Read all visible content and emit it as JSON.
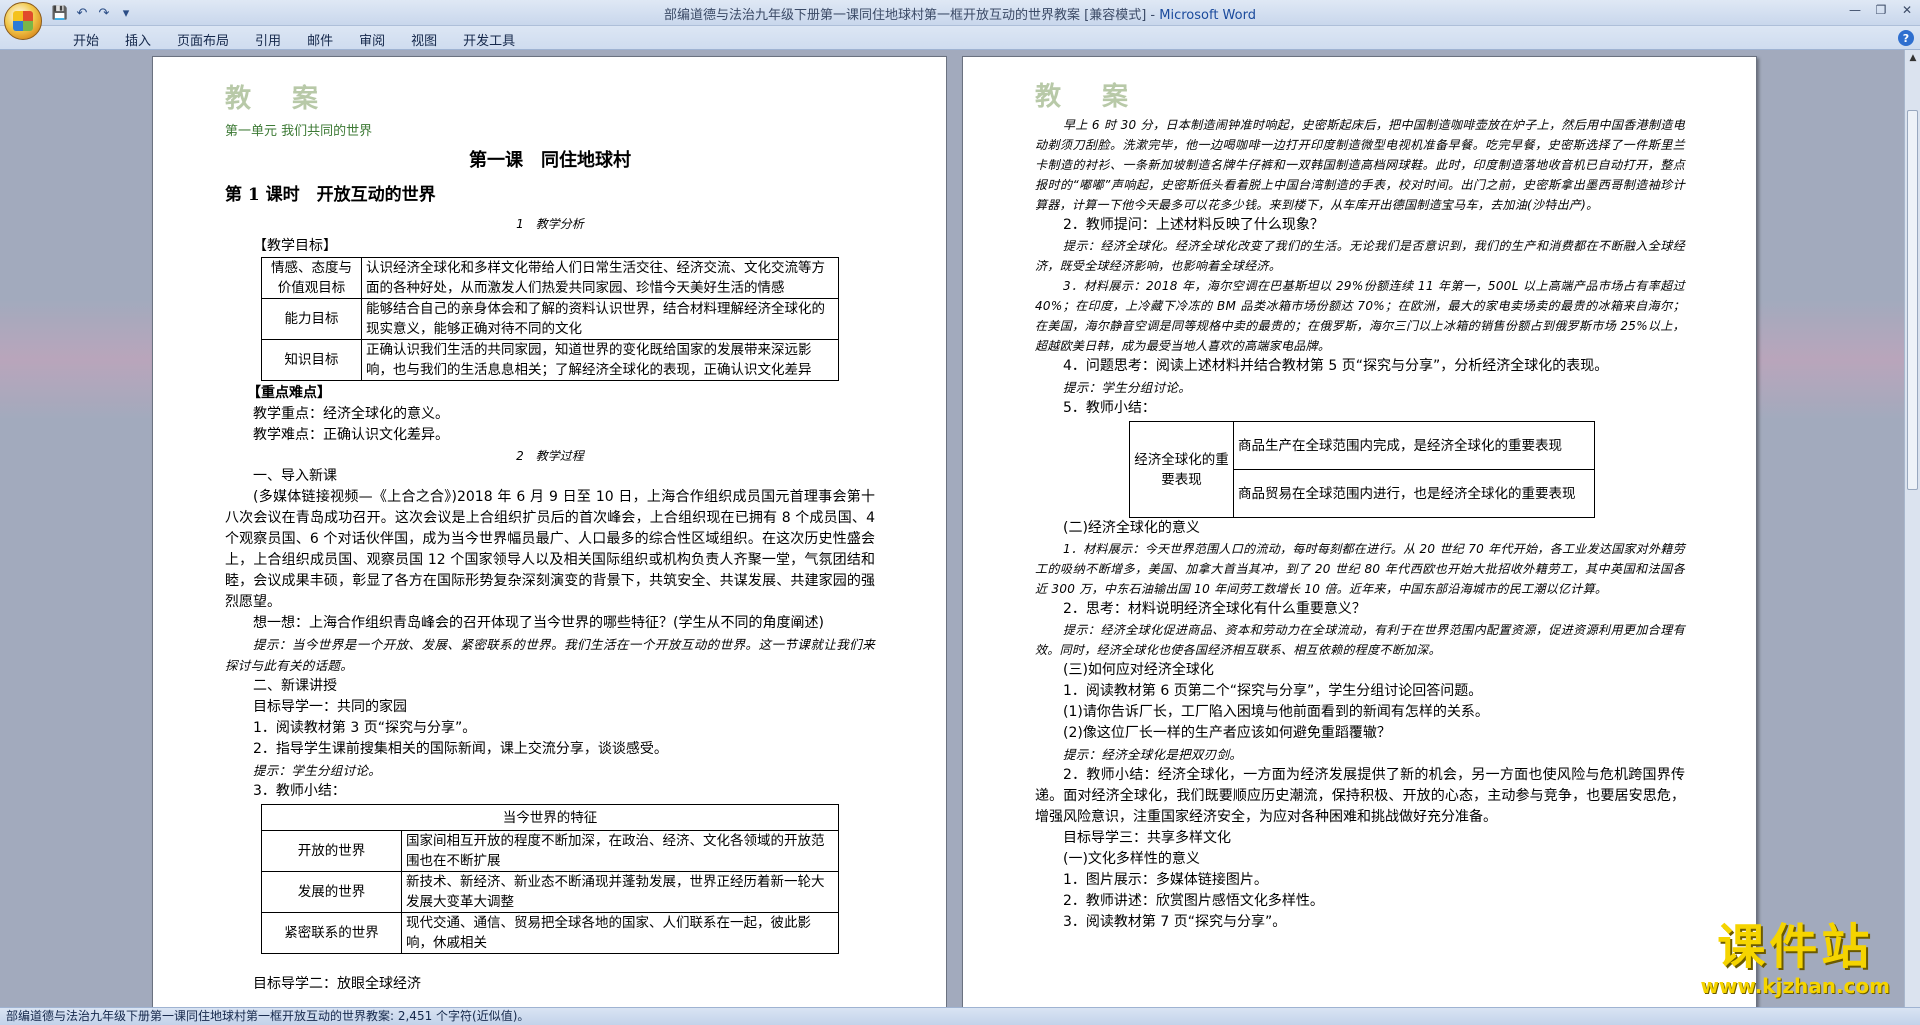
{
  "window": {
    "title_doc": "部编道德与法治九年级下册第一课同住地球村第一框开放互动的世界教案 [兼容模式] - ",
    "title_app": "Microsoft Word"
  },
  "qat": {
    "save": "💾",
    "undo": "↶",
    "redo": "↷",
    "more": "▾"
  },
  "tabs": [
    "开始",
    "插入",
    "页面布局",
    "引用",
    "邮件",
    "审阅",
    "视图",
    "开发工具"
  ],
  "win_buttons": {
    "minimize": "—",
    "maximize": "❐",
    "close": "✕"
  },
  "help": "?",
  "page1": {
    "header": "教 案",
    "unit": "第一单元  我们共同的世界",
    "lesson": "第一课　同住地球村",
    "section": "第 1 课时　开放互动的世界",
    "analysis": "1　教学分析",
    "goals_label": "【教学目标】",
    "goals": [
      {
        "name": "情感、态度与价值观目标",
        "text": "认识经济全球化和多样文化带给人们日常生活交往、经济交流、文化交流等方面的各种好处，从而激发人们热爱共同家园、珍惜今天美好生活的情感"
      },
      {
        "name": "能力目标",
        "text": "能够结合自己的亲身体会和了解的资料认识世界，结合材料理解经济全球化的现实意义，能够正确对待不同的文化"
      },
      {
        "name": "知识目标",
        "text": "正确认识我们生活的共同家园，知道世界的变化既给国家的发展带来深远影响，也与我们的生活息息相关；了解经济全球化的表现，正确认识文化差异"
      }
    ],
    "key_label": "【重点难点】",
    "key_point": "教学重点：经济全球化的意义。",
    "difficulty": "教学难点：正确认识文化差异。",
    "process": "2　教学过程",
    "intro_h": "一、导入新课",
    "intro_p": "(多媒体链接视频—《上合之合》)2018 年 6 月 9 日至 10 日，上海合作组织成员国元首理事会第十八次会议在青岛成功召开。这次会议是上合组织扩员后的首次峰会，上合组织现在已拥有 8 个成员国、4 个观察员国、6 个对话伙伴国，成为当今世界幅员最广、人口最多的综合性区域组织。在这次历史性盛会上，上合组织成员国、观察员国 12 个国家领导人以及相关国际组织或机构负责人齐聚一堂，气氛团结和睦，会议成果丰硕，彰显了各方在国际形势复杂深刻演变的背景下，共筑安全、共谋发展、共建家园的强烈愿望。",
    "think": "想一想：上海合作组织青岛峰会的召开体现了当今世界的哪些特征？(学生从不同的角度阐述)",
    "hint1": "提示：当今世界是一个开放、发展、紧密联系的世界。我们生活在一个开放互动的世界。这一节课就让我们来探讨与此有关的话题。",
    "new_h": "二、新课讲授",
    "goal1": "目标导学一：共同的家园",
    "step1": "1．阅读教材第 3 页“探究与分享”。",
    "step2": "2．指导学生课前搜集相关的国际新闻，课上交流分享，谈谈感受。",
    "hint2": "提示：学生分组讨论。",
    "step3": "3．教师小结：",
    "feature_title": "当今世界的特征",
    "features": [
      {
        "name": "开放的世界",
        "text": "国家间相互开放的程度不断加深，在政治、经济、文化各领域的开放范围也在不断扩展"
      },
      {
        "name": "发展的世界",
        "text": "新技术、新经济、新业态不断涌现并蓬勃发展，世界正经历着新一轮大发展大变革大调整"
      },
      {
        "name": "紧密联系的世界",
        "text": "现代交通、通信、贸易把全球各地的国家、人们联系在一起，彼此影响，休戚相关"
      }
    ],
    "goal2": "目标导学二：放眼全球经济"
  },
  "page2": {
    "header": "教 案",
    "p1": "早上 6 时 30 分，日本制造闹钟准时响起，史密斯起床后，把中国制造咖啡壶放在炉子上，然后用中国香港制造电动剃须刀刮脸。洗漱完毕，他一边喝咖啡一边打开印度制造微型电视机准备早餐。吃完早餐，史密斯选择了一件斯里兰卡制造的衬衫、一条新加坡制造名牌牛仔裤和一双韩国制造高档网球鞋。此时，印度制造落地收音机已自动打开，整点报时的“嘟嘟”声响起，史密斯低头看着脱上中国台湾制造的手表，校对时间。出门之前，史密斯拿出墨西哥制造袖珍计算器，计算一下他今天最多可以花多少钱。来到楼下，从车库开出德国制造宝马车，去加油(沙特出产)。",
    "q2": "2．教师提问：上述材料反映了什么现象？",
    "h2": "提示：经济全球化。经济全球化改变了我们的生活。无论我们是否意识到，我们的生产和消费都在不断融入全球经济，既受全球经济影响，也影响着全球经济。",
    "m3": "3．材料展示：2018 年，海尔空调在巴基斯坦以 29%份额连续 11 年第一，500L 以上高端产品市场占有率超过 40%；在印度，上冷藏下冷冻的 BM 品类冰箱市场份额达 70%；在欧洲，最大的家电卖场卖的最贵的冰箱来自海尔；在美国，海尔静音空调是同等规格中卖的最贵的；在俄罗斯，海尔三门以上冰箱的销售份额占到俄罗斯市场 25%以上，超越欧美日韩，成为最受当地人喜欢的高端家电品牌。",
    "q4": "4．问题思考：阅读上述材料并结合教材第 5 页“探究与分享”，分析经济全球化的表现。",
    "h4": "提示：学生分组讨论。",
    "s5": "5．教师小结：",
    "eg_name": "经济全球化的重要表现",
    "eg_rows": [
      "商品生产在全球范围内完成，是经济全球化的重要表现",
      "商品贸易在全球范围内进行，也是经济全球化的重要表现"
    ],
    "sec2": "(二)经济全球化的意义",
    "m1": "1．材料展示：今天世界范围人口的流动，每时每刻都在进行。从 20 世纪 70 年代开始，各工业发达国家对外籍劳工的吸纳不断增多，美国、加拿大首当其冲，到了 20 世纪 80 年代西欧也开始大批招收外籍劳工，其中英国和法国各近 300 万，中东石油输出国 10 年间劳工数增长 10 倍。近年来，中国东部沿海城市的民工潮以亿计算。",
    "t2": "2．思考：材料说明经济全球化有什么重要意义？",
    "h5": "提示：经济全球化促进商品、资本和劳动力在全球流动，有利于在世界范围内配置资源，促进资源利用更加合理有效。同时，经济全球化也使各国经济相互联系、相互依赖的程度不断加深。",
    "sec3": "(三)如何应对经济全球化",
    "r1": "1．阅读教材第 6 页第二个“探究与分享”，学生分组讨论回答问题。",
    "r1a": "(1)请你告诉厂长，工厂陷入困境与他前面看到的新闻有怎样的关系。",
    "r1b": "(2)像这位厂长一样的生产者应该如何避免重蹈覆辙？",
    "h6": "提示：经济全球化是把双刃剑。",
    "r2": "2．教师小结：经济全球化，一方面为经济发展提供了新的机会，另一方面也使风险与危机跨国界传递。面对经济全球化，我们既要顺应历史潮流，保持积极、开放的心态，主动参与竞争，也要居安思危，增强风险意识，注重国家经济安全，为应对各种困难和挑战做好充分准备。",
    "goal3": "目标导学三：共享多样文化",
    "c1": "(一)文化多样性的意义",
    "c2": "1．图片展示：多媒体链接图片。",
    "c3": "2．教师讲述：欣赏图片感悟文化多样性。",
    "c4": "3．阅读教材第 7 页“探究与分享”。"
  },
  "status": "部编道德与法治九年级下册第一课同住地球村第一框开放互动的世界教案: 2,451 个字符(近似值)。",
  "watermark": {
    "text": "课件站",
    "url": "www.kjzhan.com"
  }
}
